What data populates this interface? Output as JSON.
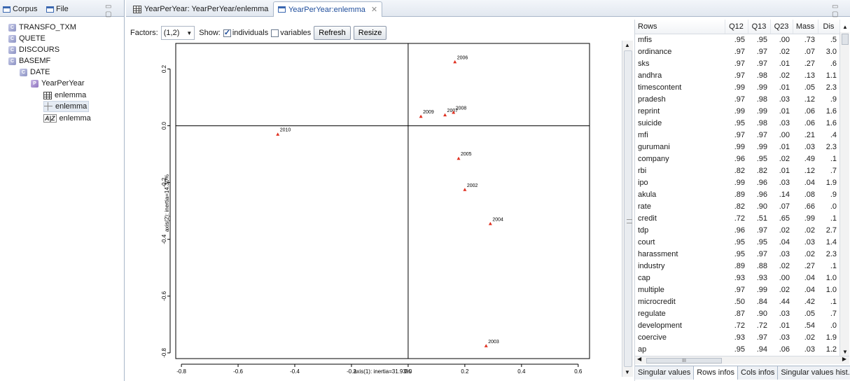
{
  "left_panel": {
    "tabs": [
      {
        "label": "Corpus"
      },
      {
        "label": "File"
      }
    ],
    "minmax": "▭ ▢",
    "tree": [
      {
        "label": "TRANSFO_TXM",
        "icon": "corpus-icon"
      },
      {
        "label": "QUETE",
        "icon": "corpus-icon"
      },
      {
        "label": "DISCOURS",
        "icon": "corpus-icon"
      },
      {
        "label": "BASEMF",
        "icon": "corpus-icon"
      },
      {
        "label": "DATE",
        "icon": "corpus-icon"
      },
      {
        "label": "YearPerYear",
        "icon": "partition-icon"
      },
      {
        "label": "enlemma",
        "icon": "table-icon"
      },
      {
        "label": "enlemma",
        "icon": "cross-icon"
      },
      {
        "label": "enlemma",
        "icon": "lexicon-icon"
      }
    ]
  },
  "editor": {
    "tabs": [
      {
        "label": "YearPerYear: YearPerYear/enlemma"
      },
      {
        "label": "YearPerYear:enlemma"
      }
    ],
    "minmax": "▭ ▢",
    "toolbar": {
      "factors_label": "Factors:",
      "factors_value": "(1,2)",
      "show_label": "Show:",
      "individuals_label": "individuals",
      "individuals_checked": true,
      "variables_label": "variables",
      "variables_checked": false,
      "refresh_label": "Refresh",
      "resize_label": "Resize"
    }
  },
  "chart_data": {
    "type": "scatter",
    "xlabel": "axis(1): inertia=31.93%",
    "ylabel": "axis(2): inertia=14.30%",
    "xlim": [
      -0.82,
      0.64
    ],
    "ylim": [
      -0.82,
      0.29
    ],
    "xticks": [
      -0.8,
      -0.6,
      -0.4,
      -0.2,
      0.0,
      0.2,
      0.4,
      0.6
    ],
    "xtick_labels": [
      "-0.8",
      "-0.6",
      "-0.4",
      "-0.2",
      "0.0",
      "0.2",
      "0.4",
      "0.6"
    ],
    "yticks": [
      0.2,
      0.0,
      -0.2,
      -0.4,
      -0.6,
      -0.8
    ],
    "ytick_labels": [
      "0.2",
      "0.0",
      "-0.2",
      "-0.4",
      "-0.6",
      "-0.8"
    ],
    "marker_color": "#e03020",
    "points": [
      {
        "label": "2006",
        "x": 0.165,
        "y": 0.225
      },
      {
        "label": "2009",
        "x": 0.045,
        "y": 0.033
      },
      {
        "label": "2007",
        "x": 0.13,
        "y": 0.038
      },
      {
        "label": "2008",
        "x": 0.16,
        "y": 0.047
      },
      {
        "label": "2010",
        "x": -0.46,
        "y": -0.03
      },
      {
        "label": "2005",
        "x": 0.178,
        "y": -0.115
      },
      {
        "label": "2002",
        "x": 0.2,
        "y": -0.225
      },
      {
        "label": "2004",
        "x": 0.29,
        "y": -0.345
      },
      {
        "label": "2003",
        "x": 0.275,
        "y": -0.775
      }
    ]
  },
  "rows_table": {
    "columns": [
      "Rows",
      "Q12",
      "Q13",
      "Q23",
      "Mass",
      "Dis"
    ],
    "rows": [
      [
        "mfis",
        ".95",
        ".95",
        ".00",
        ".73",
        ".5"
      ],
      [
        "ordinance",
        ".97",
        ".97",
        ".02",
        ".07",
        "3.0"
      ],
      [
        "sks",
        ".97",
        ".97",
        ".01",
        ".27",
        ".6"
      ],
      [
        "andhra",
        ".97",
        ".98",
        ".02",
        ".13",
        "1.1"
      ],
      [
        "timescontent",
        ".99",
        ".99",
        ".01",
        ".05",
        "2.3"
      ],
      [
        "pradesh",
        ".97",
        ".98",
        ".03",
        ".12",
        ".9"
      ],
      [
        "reprint",
        ".99",
        ".99",
        ".01",
        ".06",
        "1.6"
      ],
      [
        "suicide",
        ".95",
        ".98",
        ".03",
        ".06",
        "1.6"
      ],
      [
        "mfi",
        ".97",
        ".97",
        ".00",
        ".21",
        ".4"
      ],
      [
        "gurumani",
        ".99",
        ".99",
        ".01",
        ".03",
        "2.3"
      ],
      [
        "company",
        ".96",
        ".95",
        ".02",
        ".49",
        ".1"
      ],
      [
        "rbi",
        ".82",
        ".82",
        ".01",
        ".12",
        ".7"
      ],
      [
        "ipo",
        ".99",
        ".96",
        ".03",
        ".04",
        "1.9"
      ],
      [
        "akula",
        ".89",
        ".96",
        ".14",
        ".08",
        ".9"
      ],
      [
        "rate",
        ".82",
        ".90",
        ".07",
        ".66",
        ".0"
      ],
      [
        "credit",
        ".72",
        ".51",
        ".65",
        ".99",
        ".1"
      ],
      [
        "tdp",
        ".96",
        ".97",
        ".02",
        ".02",
        "2.7"
      ],
      [
        "court",
        ".95",
        ".95",
        ".04",
        ".03",
        "1.4"
      ],
      [
        "harassment",
        ".95",
        ".97",
        ".03",
        ".02",
        "2.3"
      ],
      [
        "industry",
        ".89",
        ".88",
        ".02",
        ".27",
        ".1"
      ],
      [
        "cap",
        ".93",
        ".93",
        ".00",
        ".04",
        "1.0"
      ],
      [
        "multiple",
        ".97",
        ".99",
        ".02",
        ".04",
        "1.0"
      ],
      [
        "microcredit",
        ".50",
        ".84",
        ".44",
        ".42",
        ".1"
      ],
      [
        "regulate",
        ".87",
        ".90",
        ".03",
        ".05",
        ".7"
      ],
      [
        "development",
        ".72",
        ".72",
        ".01",
        ".54",
        ".0"
      ],
      [
        "coercive",
        ".93",
        ".97",
        ".03",
        ".02",
        "1.9"
      ],
      [
        "ap",
        ".95",
        ".94",
        ".06",
        ".03",
        "1.2"
      ]
    ],
    "hscroll_grip": "III",
    "bottom_tabs": [
      {
        "label": "Singular values"
      },
      {
        "label": "Rows infos"
      },
      {
        "label": "Cols infos"
      },
      {
        "label": "Singular values hist..."
      }
    ]
  }
}
